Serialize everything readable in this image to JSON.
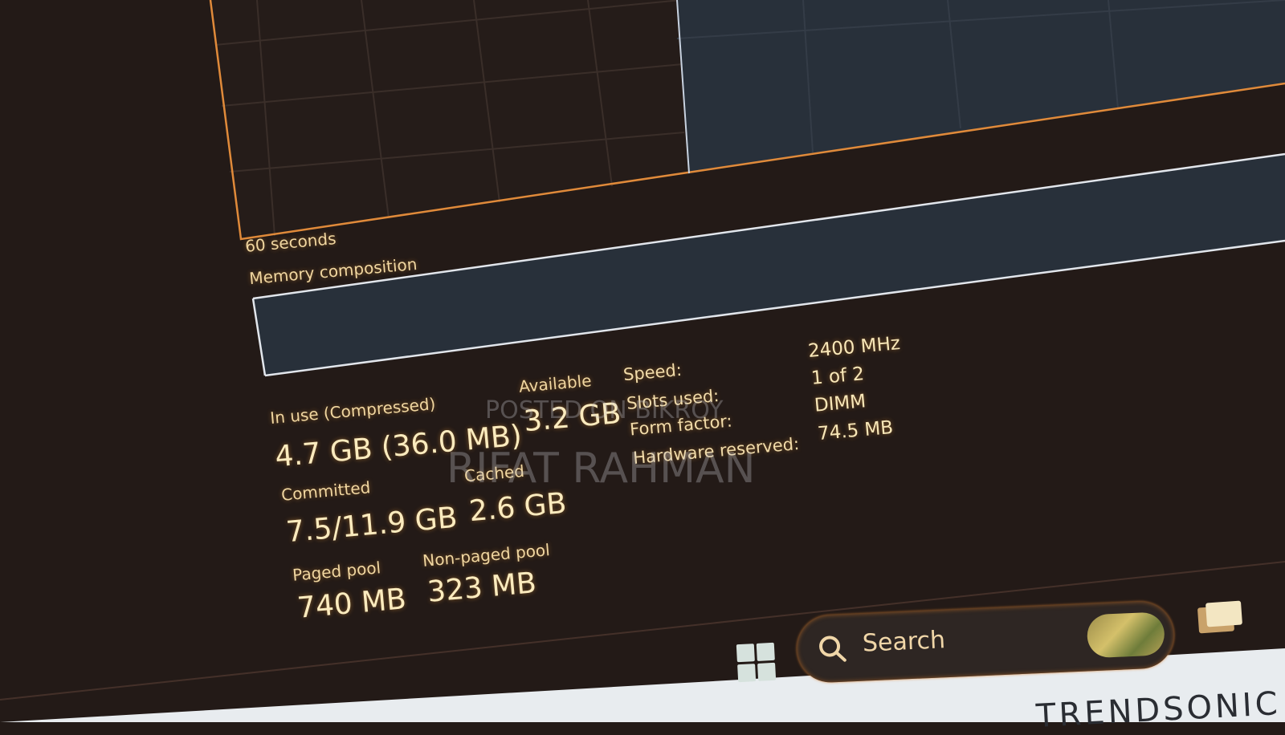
{
  "graph": {
    "time_label": "60 seconds"
  },
  "composition": {
    "title": "Memory composition"
  },
  "stats": {
    "in_use": {
      "label": "In use (Compressed)",
      "value": "4.7 GB (36.0 MB)"
    },
    "available": {
      "label": "Available",
      "value": "3.2 GB"
    },
    "committed": {
      "label": "Committed",
      "value": "7.5/11.9 GB"
    },
    "cached": {
      "label": "Cached",
      "value": "2.6 GB"
    },
    "paged_pool": {
      "label": "Paged pool",
      "value": "740 MB"
    },
    "non_paged_pool": {
      "label": "Non-paged pool",
      "value": "323 MB"
    }
  },
  "specs": {
    "speed": {
      "label": "Speed:",
      "value": "2400 MHz"
    },
    "slots_used": {
      "label": "Slots used:",
      "value": "1 of 2"
    },
    "form_factor": {
      "label": "Form factor:",
      "value": "DIMM"
    },
    "hardware_reserved": {
      "label": "Hardware reserved:",
      "value": "74.5 MB"
    }
  },
  "watermarks": {
    "line1": "POSTED ON BIKROY",
    "line2": "RIFAT RAHMAN"
  },
  "taskbar": {
    "search_label": "Search"
  },
  "monitor": {
    "brand": "TRENDSONIC"
  },
  "colors": {
    "accent": "#e08a3a",
    "graph_fill": "#28303a",
    "text": "#f3e3b0"
  },
  "icons": {
    "start": "windows-logo-icon",
    "search": "search-icon",
    "files": "folder-icon"
  }
}
